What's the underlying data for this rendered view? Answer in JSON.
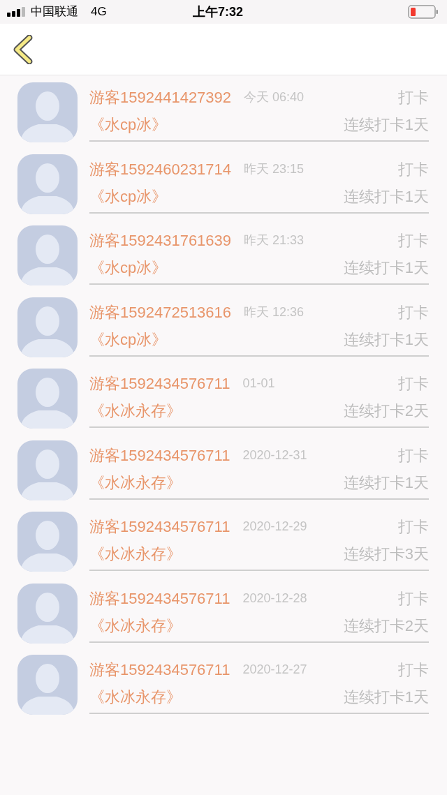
{
  "status_bar": {
    "carrier": "中国联通",
    "network": "4G",
    "time": "上午7:32"
  },
  "records": [
    {
      "name": "游客1592441427392",
      "time": "今天 06:40",
      "action": "打卡",
      "work": "《水cp冰》",
      "streak": "连续打卡1天"
    },
    {
      "name": "游客1592460231714",
      "time": "昨天 23:15",
      "action": "打卡",
      "work": "《水cp冰》",
      "streak": "连续打卡1天"
    },
    {
      "name": "游客1592431761639",
      "time": "昨天 21:33",
      "action": "打卡",
      "work": "《水cp冰》",
      "streak": "连续打卡1天"
    },
    {
      "name": "游客1592472513616",
      "time": "昨天 12:36",
      "action": "打卡",
      "work": "《水cp冰》",
      "streak": "连续打卡1天"
    },
    {
      "name": "游客1592434576711",
      "time": "01-01",
      "action": "打卡",
      "work": "《水冰永存》",
      "streak": "连续打卡2天"
    },
    {
      "name": "游客1592434576711",
      "time": "2020-12-31",
      "action": "打卡",
      "work": "《水冰永存》",
      "streak": "连续打卡1天"
    },
    {
      "name": "游客1592434576711",
      "time": "2020-12-29",
      "action": "打卡",
      "work": "《水冰永存》",
      "streak": "连续打卡3天"
    },
    {
      "name": "游客1592434576711",
      "time": "2020-12-28",
      "action": "打卡",
      "work": "《水冰永存》",
      "streak": "连续打卡2天"
    },
    {
      "name": "游客1592434576711",
      "time": "2020-12-27",
      "action": "打卡",
      "work": "《水冰永存》",
      "streak": "连续打卡1天"
    }
  ]
}
